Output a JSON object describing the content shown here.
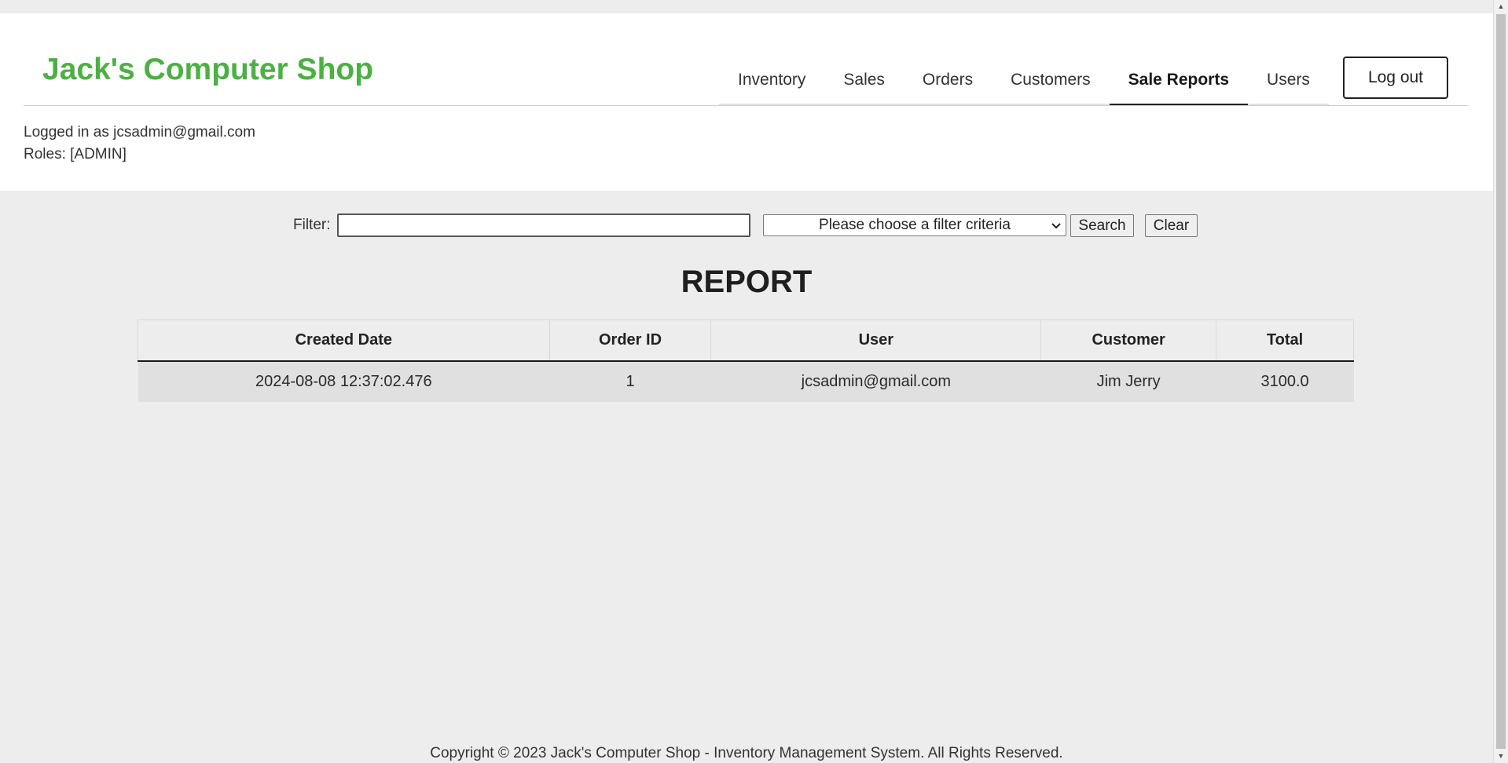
{
  "header": {
    "brand": "Jack's Computer Shop",
    "nav": [
      {
        "label": "Inventory",
        "active": false
      },
      {
        "label": "Sales",
        "active": false
      },
      {
        "label": "Orders",
        "active": false
      },
      {
        "label": "Customers",
        "active": false
      },
      {
        "label": "Sale Reports",
        "active": true
      },
      {
        "label": "Users",
        "active": false
      }
    ],
    "logout_label": "Log out",
    "logged_in_text": "Logged in as jcsadmin@gmail.com",
    "roles_text": "Roles: [ADMIN]"
  },
  "filter": {
    "label": "Filter:",
    "input_value": "",
    "select_value": "Please choose a filter criteria",
    "search_label": "Search",
    "clear_label": "Clear"
  },
  "report": {
    "title": "REPORT",
    "columns": [
      "Created Date",
      "Order ID",
      "User",
      "Customer",
      "Total"
    ],
    "rows": [
      [
        "2024-08-08 12:37:02.476",
        "1",
        "jcsadmin@gmail.com",
        "Jim Jerry",
        "3100.0"
      ]
    ]
  },
  "footer": {
    "text": "Copyright © 2023 Jack's Computer Shop - Inventory Management System. All Rights Reserved."
  },
  "colors": {
    "brand": "#4cb043",
    "background": "#ededed",
    "header_background": "#ffffff",
    "row_background": "#e0e0e0"
  }
}
